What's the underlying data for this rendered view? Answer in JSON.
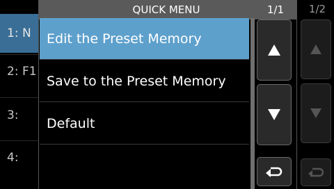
{
  "background": {
    "list_items": [
      {
        "label": "1: N"
      },
      {
        "label": "2: F1"
      },
      {
        "label": "3:"
      },
      {
        "label": "4:"
      }
    ],
    "page_indicator": "1/2"
  },
  "quick_menu": {
    "title": "QUICK MENU",
    "page_indicator": "1/1",
    "items": [
      {
        "label": "Edit the Preset Memory",
        "selected": true
      },
      {
        "label": "Save to the Preset Memory",
        "selected": false
      },
      {
        "label": "Default",
        "selected": false
      },
      {
        "label": "",
        "selected": false
      }
    ]
  },
  "icons": {
    "up": "up-arrow-icon",
    "down": "down-arrow-icon",
    "back": "return-arrow-icon"
  },
  "colors": {
    "selection": "#5ea0cc",
    "header": "#5a5a5a"
  }
}
